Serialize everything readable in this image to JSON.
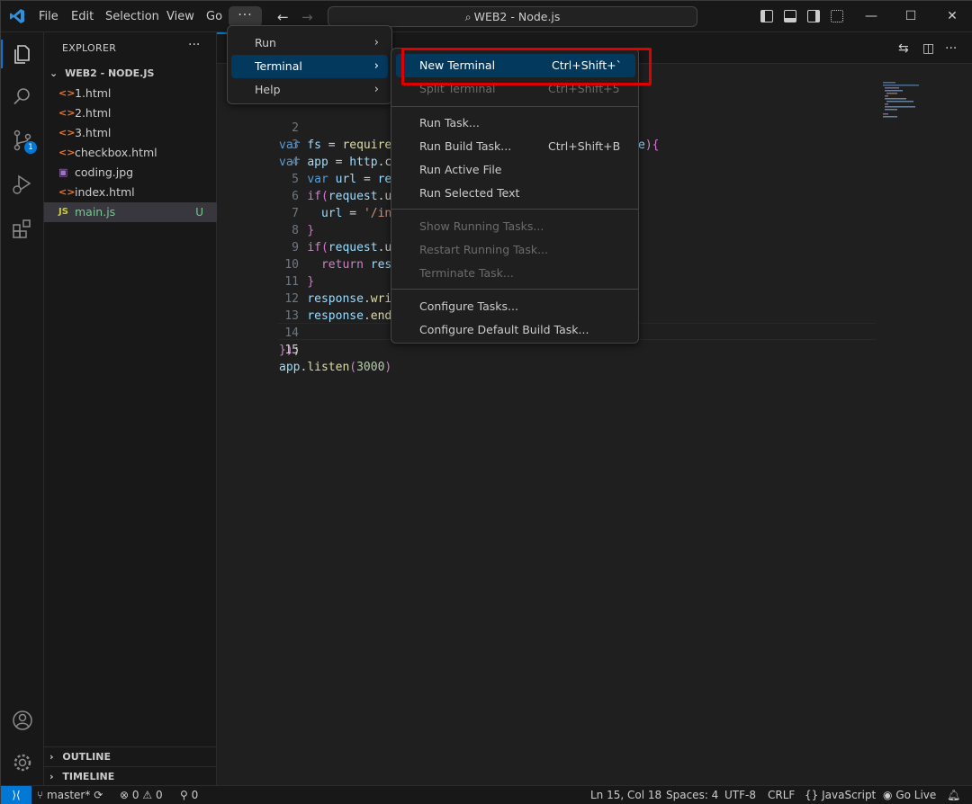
{
  "titlebar": {
    "menus": [
      "File",
      "Edit",
      "Selection",
      "View",
      "Go"
    ],
    "more": "···",
    "search_text": "WEB2 - Node.js",
    "window_buttons": {
      "minimize": "—",
      "maximize": "☐",
      "close": "✕"
    }
  },
  "activity": {
    "items": [
      "explorer-icon",
      "search-icon",
      "source-control-icon",
      "run-debug-icon",
      "extensions-icon",
      "account-icon",
      "settings-gear-icon"
    ],
    "scm_badge": "1",
    "accent": "#0078d4"
  },
  "sidebar": {
    "header": "EXPLORER",
    "more": "···",
    "folder": "WEB2 - NODE.JS",
    "files": [
      {
        "icon": "<>",
        "name": "1.html",
        "color": "#e37933"
      },
      {
        "icon": "<>",
        "name": "2.html",
        "color": "#e37933"
      },
      {
        "icon": "<>",
        "name": "3.html",
        "color": "#e37933"
      },
      {
        "icon": "<>",
        "name": "checkbox.html",
        "color": "#e37933"
      },
      {
        "icon": "▣",
        "name": "coding.jpg",
        "color": "#a074c4"
      },
      {
        "icon": "<>",
        "name": "index.html",
        "color": "#e37933"
      },
      {
        "icon": "JS",
        "name": "main.js",
        "color": "#cbcb41",
        "status": "U"
      }
    ],
    "outline": "OUTLINE",
    "timeline": "TIMELINE"
  },
  "editor": {
    "line_numbers": [
      "2",
      "3",
      "4",
      "5",
      "6",
      "7",
      "8",
      "9",
      "10",
      "11",
      "12",
      "13",
      "14",
      "15"
    ],
    "current_line": "15"
  },
  "menus": {
    "more_menu": [
      {
        "label": "Run"
      },
      {
        "label": "Terminal"
      },
      {
        "label": "Help"
      }
    ],
    "terminal_menu": [
      {
        "label": "New Terminal",
        "key": "Ctrl+Shift+`"
      },
      {
        "label": "Split Terminal",
        "key": "Ctrl+Shift+5"
      },
      {
        "label": "Run Task..."
      },
      {
        "label": "Run Build Task...",
        "key": "Ctrl+Shift+B"
      },
      {
        "label": "Run Active File"
      },
      {
        "label": "Run Selected Text"
      },
      {
        "label": "Show Running Tasks..."
      },
      {
        "label": "Restart Running Task..."
      },
      {
        "label": "Terminate Task..."
      },
      {
        "label": "Configure Tasks..."
      },
      {
        "label": "Configure Default Build Task..."
      }
    ]
  },
  "statusbar": {
    "remote": "⟩⟨",
    "branch": "master*",
    "errors": "0",
    "warnings": "0",
    "ports": "0",
    "position": "Ln 15, Col 18",
    "spaces": "Spaces: 4",
    "encoding": "UTF-8",
    "eol": "CRLF",
    "language": "JavaScript",
    "golive": "Go Live"
  }
}
